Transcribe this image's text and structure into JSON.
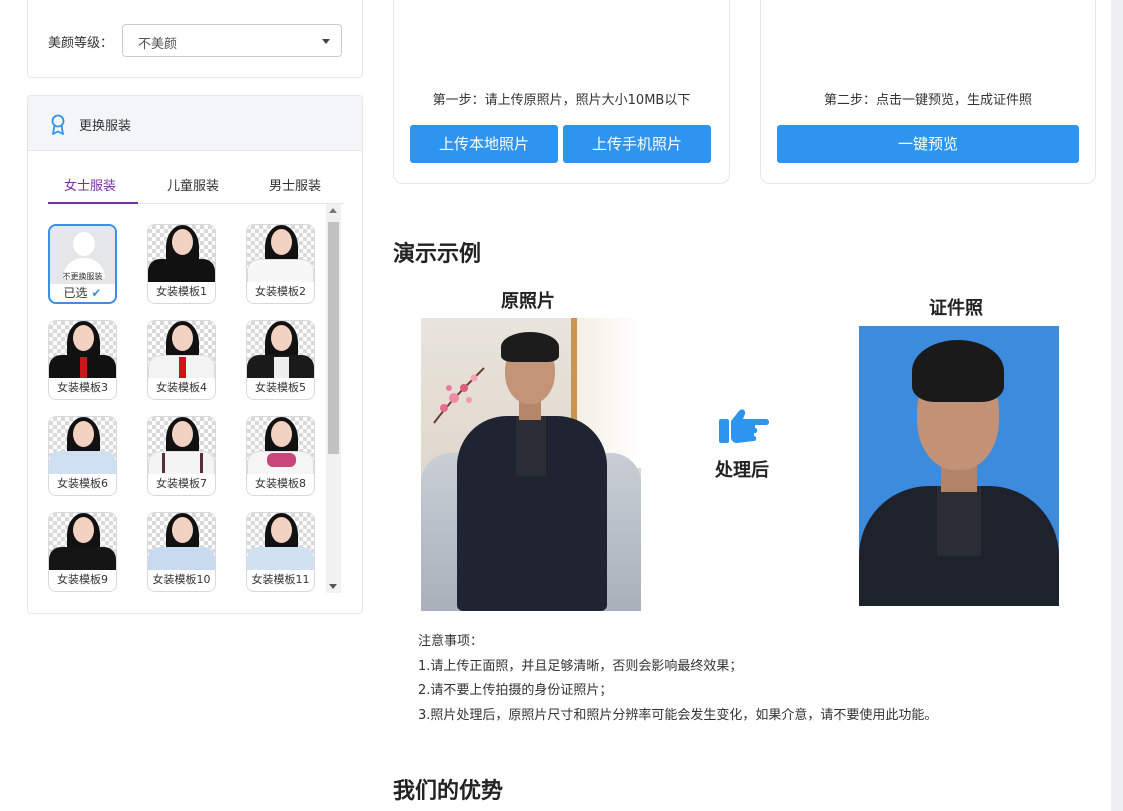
{
  "beauty": {
    "label": "美颜等级：",
    "value": "不美颜"
  },
  "clothes": {
    "title": "更换服装",
    "tabs": [
      "女士服装",
      "儿童服装",
      "男士服装"
    ],
    "none_text": "不更换服装",
    "selected_text": "已选",
    "templates": [
      "女装模板1",
      "女装模板2",
      "女装模板3",
      "女装模板4",
      "女装模板5",
      "女装模板6",
      "女装模板7",
      "女装模板8",
      "女装模板9",
      "女装模板10",
      "女装模板11"
    ]
  },
  "upload": {
    "step1": "第一步：请上传原照片，照片大小10MB以下",
    "local_btn": "上传本地照片",
    "phone_btn": "上传手机照片",
    "step2": "第二步：点击一键预览，生成证件照",
    "preview_btn": "一键预览"
  },
  "demo": {
    "title": "演示示例",
    "original_label": "原照片",
    "processed_label": "处理后",
    "id_label": "证件照"
  },
  "notes": {
    "title": "注意事项：",
    "items": [
      "1.请上传正面照，并且足够清晰，否则会影响最终效果；",
      "2.请不要上传拍摄的身份证照片；",
      "3.照片处理后，原照片尺寸和照片分辨率可能会发生变化，如果介意，请不要使用此功能。"
    ]
  },
  "advantages": {
    "title": "我们的优势"
  },
  "colors": {
    "accent": "#2d94f0",
    "tab_active": "#7b2fa5",
    "id_background": "#3d8bdc"
  },
  "icons": {
    "clothes": "award-ribbon-icon",
    "processed": "hand-pointing-right-icon",
    "selected": "checkmark-icon"
  }
}
